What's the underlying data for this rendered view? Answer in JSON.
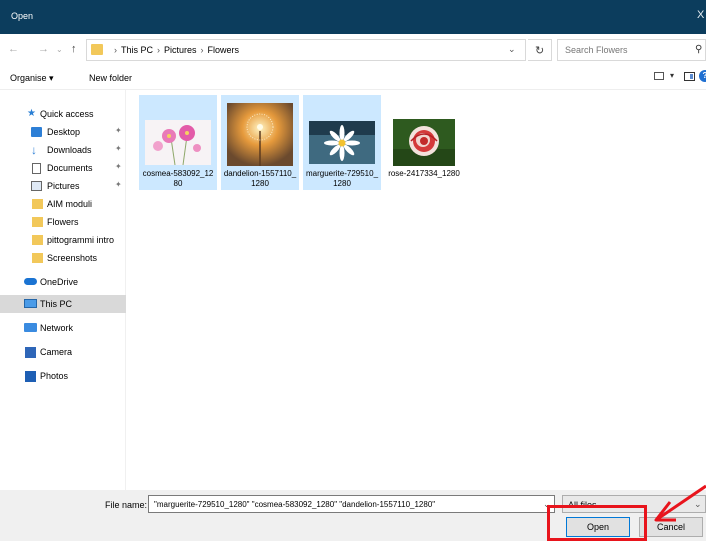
{
  "window": {
    "title": "Open",
    "close_glyph": "X"
  },
  "nav": {
    "back_icon": "arrow-left-icon",
    "forward_icon": "arrow-right-icon",
    "recent_icon": "chevron-down-icon",
    "up_icon": "arrow-up-icon",
    "breadcrumb": [
      "This PC",
      "Pictures",
      "Flowers"
    ],
    "search_placeholder": "Search Flowers"
  },
  "toolbar": {
    "organise_label": "Organise ▾",
    "new_folder_label": "New folder"
  },
  "sidebar": {
    "quick_access": "Quick access",
    "items": [
      {
        "label": "Desktop",
        "icon": "desktop-icon",
        "pinned": true
      },
      {
        "label": "Downloads",
        "icon": "download-icon",
        "pinned": true
      },
      {
        "label": "Documents",
        "icon": "documents-icon",
        "pinned": true
      },
      {
        "label": "Pictures",
        "icon": "pictures-icon",
        "pinned": true
      },
      {
        "label": "AIM moduli",
        "icon": "folder-icon"
      },
      {
        "label": "Flowers",
        "icon": "folder-icon"
      },
      {
        "label": "pittogrammi intro",
        "icon": "folder-icon"
      },
      {
        "label": "Screenshots",
        "icon": "folder-icon"
      }
    ],
    "onedrive": "OneDrive",
    "this_pc": "This PC",
    "network": "Network",
    "camera": "Camera",
    "photos": "Photos"
  },
  "files": [
    {
      "name": "cosmea-583092_1280",
      "selected": true,
      "thumb": "pink-cosmos-flowers"
    },
    {
      "name": "dandelion-1557110_1280",
      "selected": true,
      "thumb": "glowing-dandelion"
    },
    {
      "name": "marguerite-729510_1280",
      "selected": true,
      "thumb": "white-daisy"
    },
    {
      "name": "rose-2417334_1280",
      "selected": false,
      "thumb": "red-white-rose"
    }
  ],
  "bottom": {
    "file_name_label": "File name:",
    "file_name_value": "\"marguerite-729510_1280\" \"cosmea-583092_1280\" \"dandelion-1557110_1280\"",
    "file_type": "All files",
    "open_label": "Open",
    "cancel_label": "Cancel"
  },
  "colors": {
    "titlebar": "#0c3d5d",
    "selection": "#cce8ff",
    "annotation": "#e8141c",
    "folder": "#f2c85a"
  }
}
